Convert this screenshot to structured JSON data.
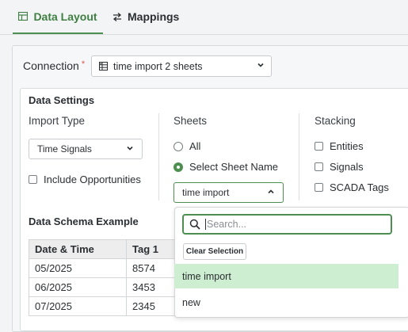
{
  "tabs": [
    {
      "label": "Data Layout",
      "icon": "table-icon",
      "active": true
    },
    {
      "label": "Mappings",
      "icon": "swap-icon",
      "active": false
    }
  ],
  "connection": {
    "label": "Connection",
    "required_mark": "*",
    "value": "time import 2 sheets",
    "icon": "excel-icon"
  },
  "data_settings": {
    "title": "Data Settings",
    "import_type": {
      "heading": "Import Type",
      "value": "Time Signals",
      "include_opportunities": {
        "label": "Include Opportunities",
        "checked": false
      }
    },
    "sheets": {
      "heading": "Sheets",
      "options": [
        {
          "label": "All",
          "selected": false
        },
        {
          "label": "Select Sheet Name",
          "selected": true
        }
      ],
      "sheet_select_value": "time import"
    },
    "stacking": {
      "heading": "Stacking",
      "options": [
        {
          "label": "Entities",
          "checked": false
        },
        {
          "label": "Signals",
          "checked": false
        },
        {
          "label": "SCADA Tags",
          "checked": false
        }
      ]
    }
  },
  "schema": {
    "title": "Data Schema Example",
    "headers": [
      "Date & Time",
      "Tag 1"
    ],
    "rows": [
      [
        "05/2025",
        "8574"
      ],
      [
        "06/2025",
        "3453"
      ],
      [
        "07/2025",
        "2345"
      ]
    ]
  },
  "dropdown": {
    "search_placeholder": "Search...",
    "clear_label": "Clear Selection",
    "options": [
      {
        "label": "time import",
        "selected": true
      },
      {
        "label": "new",
        "selected": false
      }
    ]
  },
  "colors": {
    "accent": "#4c8f50",
    "selected_option_bg": "#cdeed0",
    "required": "#d9534f"
  }
}
